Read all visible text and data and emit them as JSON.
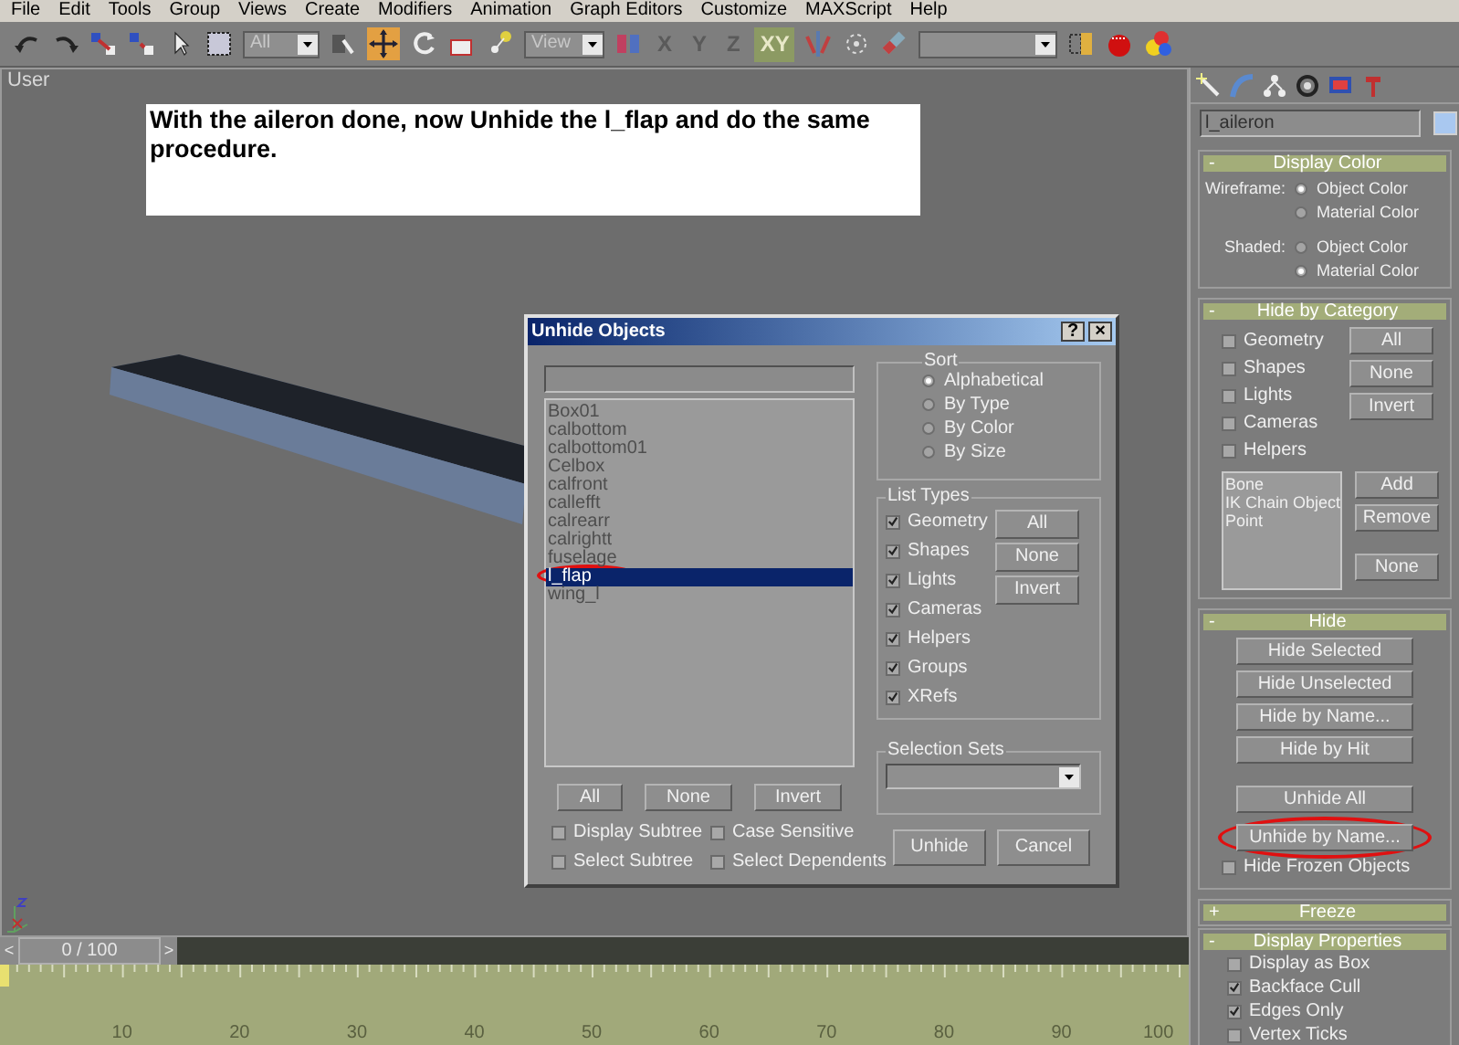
{
  "menu_bar": [
    "File",
    "Edit",
    "Tools",
    "Group",
    "Views",
    "Create",
    "Modifiers",
    "Animation",
    "Graph Editors",
    "Customize",
    "MAXScript",
    "Help"
  ],
  "toolbar": {
    "selection_filter": "All",
    "reference_coordinate": "View",
    "move_active": true,
    "axes": [
      {
        "label": "X",
        "selected": false
      },
      {
        "label": "Y",
        "selected": false
      },
      {
        "label": "Z",
        "selected": false
      },
      {
        "label": "XY",
        "selected": true
      }
    ]
  },
  "viewport": {
    "label": "User",
    "note": "With the aileron done, now Unhide the l_flap and do the same procedure."
  },
  "dialog": {
    "title": "Unhide Objects",
    "help": "?",
    "close": "×",
    "objects": [
      {
        "name": "Box01",
        "selected": false
      },
      {
        "name": "calbottom",
        "selected": false
      },
      {
        "name": "calbottom01",
        "selected": false
      },
      {
        "name": "Celbox",
        "selected": false
      },
      {
        "name": "calfront",
        "selected": false
      },
      {
        "name": "callefft",
        "selected": false
      },
      {
        "name": "calrearr",
        "selected": false
      },
      {
        "name": "calrightt",
        "selected": false
      },
      {
        "name": "fuselage",
        "selected": false
      },
      {
        "name": "l_flap",
        "selected": true
      },
      {
        "name": "wing_l",
        "selected": false
      }
    ],
    "list_buttons": [
      "All",
      "None",
      "Invert"
    ],
    "options": [
      {
        "label": "Display Subtree",
        "checked": false
      },
      {
        "label": "Case Sensitive",
        "checked": false
      },
      {
        "label": "Select Subtree",
        "checked": false
      },
      {
        "label": "Select Dependents",
        "checked": false
      }
    ],
    "sort": {
      "title": "Sort",
      "options": [
        {
          "label": "Alphabetical",
          "selected": true
        },
        {
          "label": "By Type",
          "selected": false
        },
        {
          "label": "By Color",
          "selected": false
        },
        {
          "label": "By Size",
          "selected": false
        }
      ]
    },
    "list_types": {
      "title": "List Types",
      "types": [
        {
          "label": "Geometry",
          "checked": true
        },
        {
          "label": "Shapes",
          "checked": true
        },
        {
          "label": "Lights",
          "checked": true
        },
        {
          "label": "Cameras",
          "checked": true
        },
        {
          "label": "Helpers",
          "checked": true
        },
        {
          "label": "Groups",
          "checked": true
        },
        {
          "label": "XRefs",
          "checked": true
        }
      ],
      "buttons": [
        "All",
        "None",
        "Invert"
      ]
    },
    "selection_sets": {
      "title": "Selection Sets"
    },
    "buttons": [
      "Unhide",
      "Cancel"
    ]
  },
  "command_panel": {
    "object_name": "l_aileron",
    "display_color": {
      "sign": "-",
      "title": "Display Color",
      "rows": [
        {
          "label": "Wireframe:",
          "options": [
            {
              "label": "Object Color",
              "selected": true
            },
            {
              "label": "Material Color",
              "selected": false
            }
          ]
        },
        {
          "label": "Shaded:",
          "options": [
            {
              "label": "Object Color",
              "selected": false
            },
            {
              "label": "Material Color",
              "selected": true
            }
          ]
        }
      ]
    },
    "hide_by_category": {
      "sign": "-",
      "title": "Hide by Category",
      "categories": [
        {
          "label": "Geometry",
          "checked": false
        },
        {
          "label": "Shapes",
          "checked": false
        },
        {
          "label": "Lights",
          "checked": false
        },
        {
          "label": "Cameras",
          "checked": false
        },
        {
          "label": "Helpers",
          "checked": false
        }
      ],
      "buttons": [
        "All",
        "None",
        "Invert"
      ],
      "list": [
        "Bone",
        "IK Chain Object",
        "Point"
      ],
      "list_buttons": [
        "Add",
        "Remove",
        "None"
      ]
    },
    "hide": {
      "sign": "-",
      "title": "Hide",
      "buttons": [
        "Hide Selected",
        "Hide Unselected",
        "Hide by Name...",
        "Hide by Hit"
      ],
      "unhide_buttons": [
        "Unhide All",
        "Unhide by Name..."
      ],
      "option": {
        "label": "Hide Frozen Objects",
        "checked": false
      }
    },
    "freeze": {
      "sign": "+",
      "title": "Freeze"
    },
    "display_properties": {
      "sign": "-",
      "title": "Display Properties",
      "options": [
        {
          "label": "Display as Box",
          "checked": false
        },
        {
          "label": "Backface Cull",
          "checked": true
        },
        {
          "label": "Edges Only",
          "checked": true
        },
        {
          "label": "Vertex Ticks",
          "checked": false
        }
      ]
    }
  },
  "time_slider": {
    "previous": "<",
    "label": "0 / 100",
    "next": ">",
    "level": 0
  },
  "ruler_labels": [
    "10",
    "20",
    "30",
    "40",
    "50",
    "60",
    "70",
    "80",
    "90",
    "100"
  ]
}
